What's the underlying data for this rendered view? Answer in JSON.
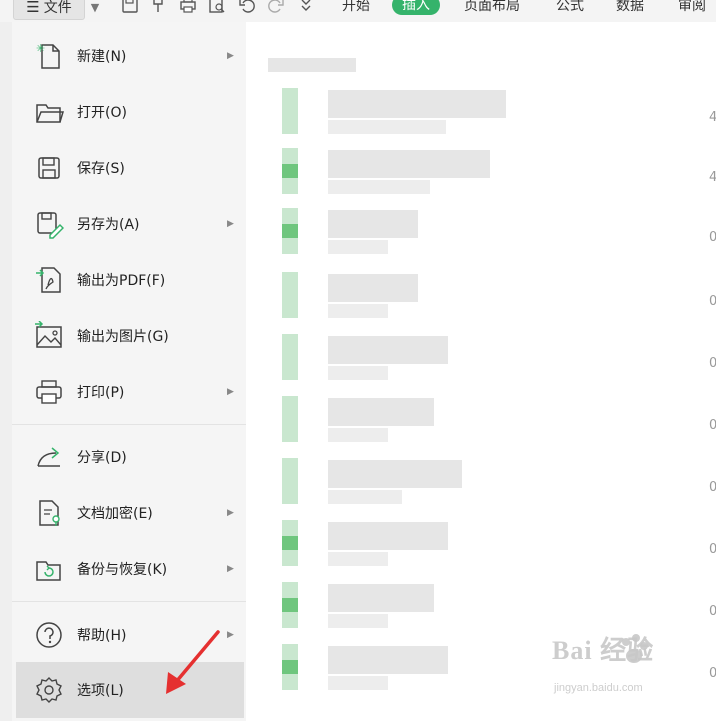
{
  "toolbar": {
    "file_label": "文件",
    "menu_icon": "hamburger-icon",
    "dropdown_icon": "chevron-down-icon",
    "quick_access": [
      "save-icon",
      "format-painter-icon",
      "print-icon",
      "print-preview-icon",
      "undo-icon",
      "redo-icon",
      "more-icon"
    ],
    "tabs": [
      {
        "label": "开始",
        "active": false
      },
      {
        "label": "插入",
        "active": true
      },
      {
        "label": "页面布局",
        "active": false
      },
      {
        "label": "公式",
        "active": false
      },
      {
        "label": "数据",
        "active": false
      },
      {
        "label": "审阅",
        "active": false
      }
    ],
    "active_tab_color": "#35b36b"
  },
  "menu": {
    "items": [
      {
        "label": "新建(N)",
        "icon": "new-document-icon",
        "has_submenu": true
      },
      {
        "label": "打开(O)",
        "icon": "open-folder-icon",
        "has_submenu": false
      },
      {
        "label": "保存(S)",
        "icon": "save-icon",
        "has_submenu": false
      },
      {
        "label": "另存为(A)",
        "icon": "save-as-icon",
        "has_submenu": true
      },
      {
        "label": "输出为PDF(F)",
        "icon": "export-pdf-icon",
        "has_submenu": false
      },
      {
        "label": "输出为图片(G)",
        "icon": "export-image-icon",
        "has_submenu": false
      },
      {
        "label": "打印(P)",
        "icon": "print-icon",
        "has_submenu": true
      },
      {
        "label": "分享(D)",
        "icon": "share-icon",
        "has_submenu": false
      },
      {
        "label": "文档加密(E)",
        "icon": "encrypt-document-icon",
        "has_submenu": true
      },
      {
        "label": "备份与恢复(K)",
        "icon": "backup-restore-icon",
        "has_submenu": true
      },
      {
        "label": "帮助(H)",
        "icon": "help-icon",
        "has_submenu": true
      },
      {
        "label": "选项(L)",
        "icon": "gear-icon",
        "has_submenu": false,
        "selected": true
      }
    ],
    "submenu_arrow": "▶"
  },
  "recent": {
    "date_prefix": [
      "4",
      "4",
      "0",
      "0",
      "0",
      "0",
      "0",
      "0",
      "0",
      "0"
    ]
  },
  "watermark": {
    "title": "Bai 经验",
    "subtitle": "jingyan.baidu.com"
  },
  "annotation": {
    "arrow_color": "#e53030"
  }
}
